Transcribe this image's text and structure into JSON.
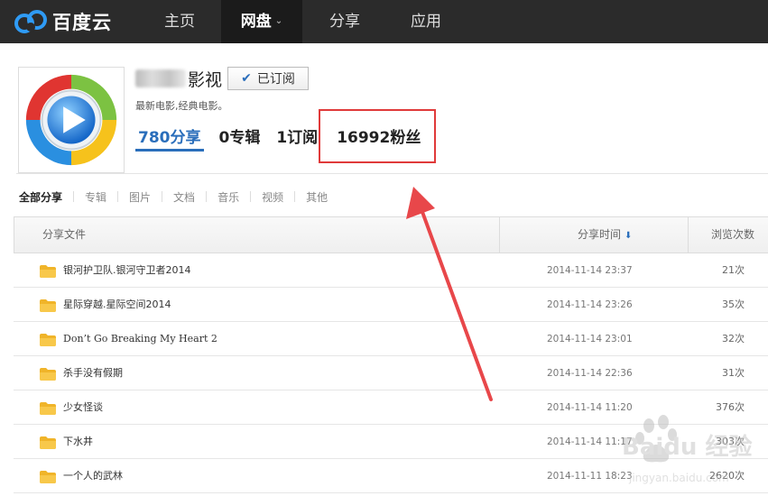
{
  "nav": {
    "logo_text": "百度云",
    "items": [
      {
        "label": "主页"
      },
      {
        "label": "网盘"
      },
      {
        "label": "分享"
      },
      {
        "label": "应用"
      }
    ]
  },
  "profile": {
    "name_suffix": "影视",
    "subscribe_label": "已订阅",
    "bio": "最新电影,经典电影。",
    "stats": [
      {
        "label": "780分享"
      },
      {
        "label": "0专辑"
      },
      {
        "label": "1订阅"
      },
      {
        "label": "16992粉丝"
      }
    ]
  },
  "filter_tabs": [
    "全部分享",
    "专辑",
    "图片",
    "文档",
    "音乐",
    "视频",
    "其他"
  ],
  "table": {
    "headers": {
      "file": "分享文件",
      "time": "分享时间",
      "views": "浏览次数"
    },
    "rows": [
      {
        "name": "银河护卫队.银河守卫者2014",
        "time": "2014-11-14 23:37",
        "views": "21次"
      },
      {
        "name": "星际穿越.星际空间2014",
        "time": "2014-11-14 23:26",
        "views": "35次"
      },
      {
        "name": "Don’t Go Breaking My Heart 2",
        "time": "2014-11-14 23:01",
        "views": "32次"
      },
      {
        "name": "杀手没有假期",
        "time": "2014-11-14 22:36",
        "views": "31次"
      },
      {
        "name": "少女怪谈",
        "time": "2014-11-14 11:20",
        "views": "376次"
      },
      {
        "name": "下水井",
        "time": "2014-11-14 11:17",
        "views": "303次"
      },
      {
        "name": "一个人的武林",
        "time": "2014-11-11 18:23",
        "views": "2620次"
      }
    ]
  },
  "watermark": {
    "text": "Baidu 经验",
    "sub": "jingyan.baidu.com"
  },
  "colors": {
    "accent": "#2a6ebb",
    "highlight": "#e03a3a",
    "arrow": "#e8474a",
    "nav_bg": "#2b2b2b"
  }
}
